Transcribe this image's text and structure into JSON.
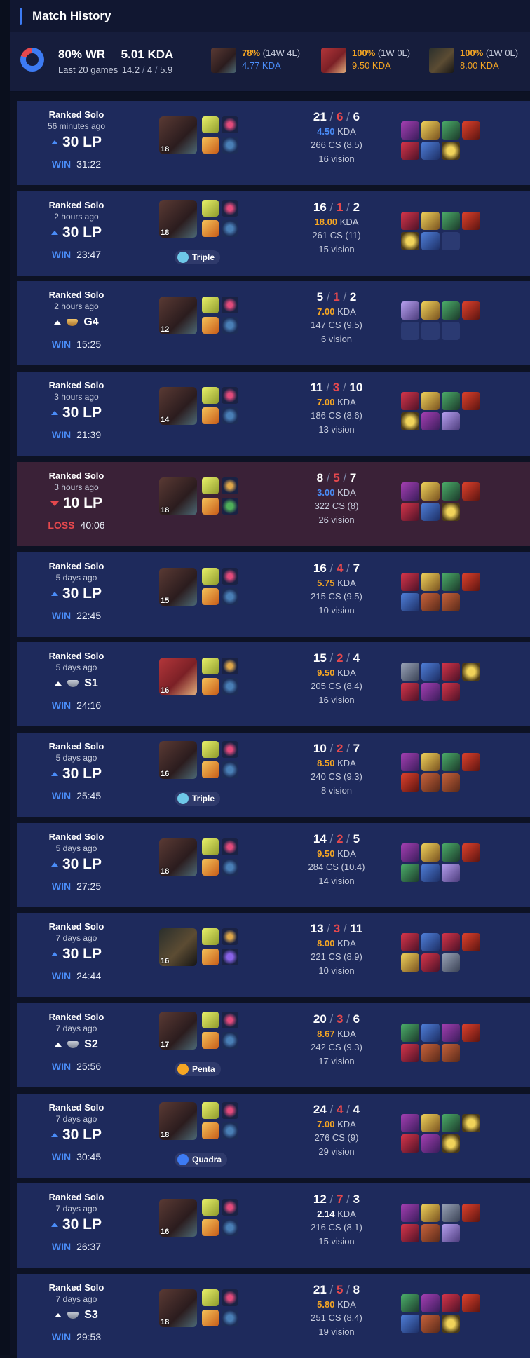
{
  "header": {
    "title": "Match History"
  },
  "summary": {
    "winrate": "80% WR",
    "winrate_fraction": 0.8,
    "games": "Last 20 games",
    "kda": "5.01 KDA",
    "kills": "14.2",
    "deaths": "4",
    "assists": "5.9",
    "sep": "/",
    "champions": [
      {
        "icon": "ekko-portrait",
        "pct": "78%",
        "record": "(14W 4L)",
        "kda": "4.77 KDA",
        "kda_color": "#4a8cf7"
      },
      {
        "icon": "lee-sin-portrait",
        "pct": "100%",
        "record": "(1W 0L)",
        "kda": "9.50 KDA",
        "kda_color": "#f5a623"
      },
      {
        "icon": "zed-portrait",
        "pct": "100%",
        "record": "(1W 0L)",
        "kda": "8.00 KDA",
        "kda_color": "#f5a623"
      }
    ]
  },
  "kda_suffix": "KDA",
  "matches": [
    {
      "queue": "Ranked Solo",
      "time": "56 minutes ago",
      "lp": "30 LP",
      "result": "WIN",
      "duration": "31:22",
      "level": "18",
      "k": "21",
      "d": "6",
      "a": "6",
      "kda": "4.50",
      "kda_color": "blue",
      "cs": "266 CS (8.5)",
      "vision": "16 vision",
      "badge": "",
      "items": [
        "purple",
        "gold",
        "green",
        "red",
        "crimson",
        "blue",
        "orb"
      ]
    },
    {
      "queue": "Ranked Solo",
      "time": "2 hours ago",
      "lp": "30 LP",
      "result": "WIN",
      "duration": "23:47",
      "level": "18",
      "k": "16",
      "d": "1",
      "a": "2",
      "kda": "18.00",
      "kda_color": "gold",
      "cs": "261 CS (11)",
      "vision": "15 vision",
      "badge": "Triple",
      "items": [
        "crimson",
        "gold",
        "green",
        "red",
        "orb",
        "blue",
        "empty"
      ]
    },
    {
      "queue": "Ranked Solo",
      "time": "2 hours ago",
      "lp": "G4",
      "result": "WIN",
      "duration": "15:25",
      "level": "12",
      "k": "5",
      "d": "1",
      "a": "2",
      "kda": "7.00",
      "kda_color": "gold",
      "cs": "147 CS (9.5)",
      "vision": "6 vision",
      "badge": "",
      "items": [
        "violet",
        "gold",
        "green",
        "red",
        "empty",
        "empty",
        "empty"
      ]
    },
    {
      "queue": "Ranked Solo",
      "time": "3 hours ago",
      "lp": "30 LP",
      "result": "WIN",
      "duration": "21:39",
      "level": "14",
      "k": "11",
      "d": "3",
      "a": "10",
      "kda": "7.00",
      "kda_color": "gold",
      "cs": "186 CS (8.6)",
      "vision": "13 vision",
      "badge": "",
      "items": [
        "crimson",
        "gold",
        "green",
        "red",
        "orb",
        "purple",
        "violet"
      ]
    },
    {
      "queue": "Ranked Solo",
      "time": "3 hours ago",
      "lp": "10 LP",
      "result": "LOSS",
      "duration": "40:06",
      "level": "18",
      "k": "8",
      "d": "5",
      "a": "7",
      "kda": "3.00",
      "kda_color": "blue",
      "cs": "322 CS (8)",
      "vision": "26 vision",
      "badge": "",
      "items": [
        "purple",
        "gold",
        "green",
        "red",
        "crimson",
        "blue",
        "orb"
      ]
    },
    {
      "queue": "Ranked Solo",
      "time": "5 days ago",
      "lp": "30 LP",
      "result": "WIN",
      "duration": "22:45",
      "level": "15",
      "k": "16",
      "d": "4",
      "a": "7",
      "kda": "5.75",
      "kda_color": "gold",
      "cs": "215 CS (9.5)",
      "vision": "10 vision",
      "badge": "",
      "items": [
        "crimson",
        "gold",
        "green",
        "red",
        "blue",
        "book",
        "book"
      ]
    },
    {
      "queue": "Ranked Solo",
      "time": "5 days ago",
      "lp": "S1",
      "result": "WIN",
      "duration": "24:16",
      "level": "16",
      "k": "15",
      "d": "2",
      "a": "4",
      "kda": "9.50",
      "kda_color": "gold",
      "cs": "205 CS (8.4)",
      "vision": "16 vision",
      "badge": "",
      "items": [
        "silver",
        "blue",
        "crimson",
        "orb",
        "crimson",
        "purple",
        "crimson"
      ]
    },
    {
      "queue": "Ranked Solo",
      "time": "5 days ago",
      "lp": "30 LP",
      "result": "WIN",
      "duration": "25:45",
      "level": "16",
      "k": "10",
      "d": "2",
      "a": "7",
      "kda": "8.50",
      "kda_color": "gold",
      "cs": "240 CS (9.3)",
      "vision": "8 vision",
      "badge": "Triple",
      "items": [
        "purple",
        "gold",
        "green",
        "red",
        "red",
        "book",
        "book"
      ]
    },
    {
      "queue": "Ranked Solo",
      "time": "5 days ago",
      "lp": "30 LP",
      "result": "WIN",
      "duration": "27:25",
      "level": "18",
      "k": "14",
      "d": "2",
      "a": "5",
      "kda": "9.50",
      "kda_color": "gold",
      "cs": "284 CS (10.4)",
      "vision": "14 vision",
      "badge": "",
      "items": [
        "purple",
        "gold",
        "green",
        "red",
        "green",
        "blue",
        "violet"
      ]
    },
    {
      "queue": "Ranked Solo",
      "time": "7 days ago",
      "lp": "30 LP",
      "result": "WIN",
      "duration": "24:44",
      "level": "16",
      "k": "13",
      "d": "3",
      "a": "11",
      "kda": "8.00",
      "kda_color": "gold",
      "cs": "221 CS (8.9)",
      "vision": "10 vision",
      "badge": "",
      "items": [
        "crimson",
        "blue",
        "crimson",
        "red",
        "gold",
        "crimson",
        "silver"
      ]
    },
    {
      "queue": "Ranked Solo",
      "time": "7 days ago",
      "lp": "S2",
      "result": "WIN",
      "duration": "25:56",
      "level": "17",
      "k": "20",
      "d": "3",
      "a": "6",
      "kda": "8.67",
      "kda_color": "gold",
      "cs": "242 CS (9.3)",
      "vision": "17 vision",
      "badge": "Penta",
      "items": [
        "green",
        "blue",
        "purple",
        "red",
        "crimson",
        "book",
        "book"
      ]
    },
    {
      "queue": "Ranked Solo",
      "time": "7 days ago",
      "lp": "30 LP",
      "result": "WIN",
      "duration": "30:45",
      "level": "18",
      "k": "24",
      "d": "4",
      "a": "4",
      "kda": "7.00",
      "kda_color": "gold",
      "cs": "276 CS (9)",
      "vision": "29 vision",
      "badge": "Quadra",
      "items": [
        "purple",
        "gold",
        "green",
        "orb",
        "crimson",
        "purple",
        "orb"
      ]
    },
    {
      "queue": "Ranked Solo",
      "time": "7 days ago",
      "lp": "30 LP",
      "result": "WIN",
      "duration": "26:37",
      "level": "16",
      "k": "12",
      "d": "7",
      "a": "3",
      "kda": "2.14",
      "kda_color": "white",
      "cs": "216 CS (8.1)",
      "vision": "15 vision",
      "badge": "",
      "items": [
        "purple",
        "gold",
        "silver",
        "red",
        "crimson",
        "book",
        "violet"
      ]
    },
    {
      "queue": "Ranked Solo",
      "time": "7 days ago",
      "lp": "S3",
      "result": "WIN",
      "duration": "29:53",
      "level": "18",
      "k": "21",
      "d": "5",
      "a": "8",
      "kda": "5.80",
      "kda_color": "gold",
      "cs": "251 CS (8.4)",
      "vision": "19 vision",
      "badge": "",
      "items": [
        "green",
        "purple",
        "crimson",
        "red",
        "blue",
        "book",
        "orb"
      ]
    }
  ]
}
